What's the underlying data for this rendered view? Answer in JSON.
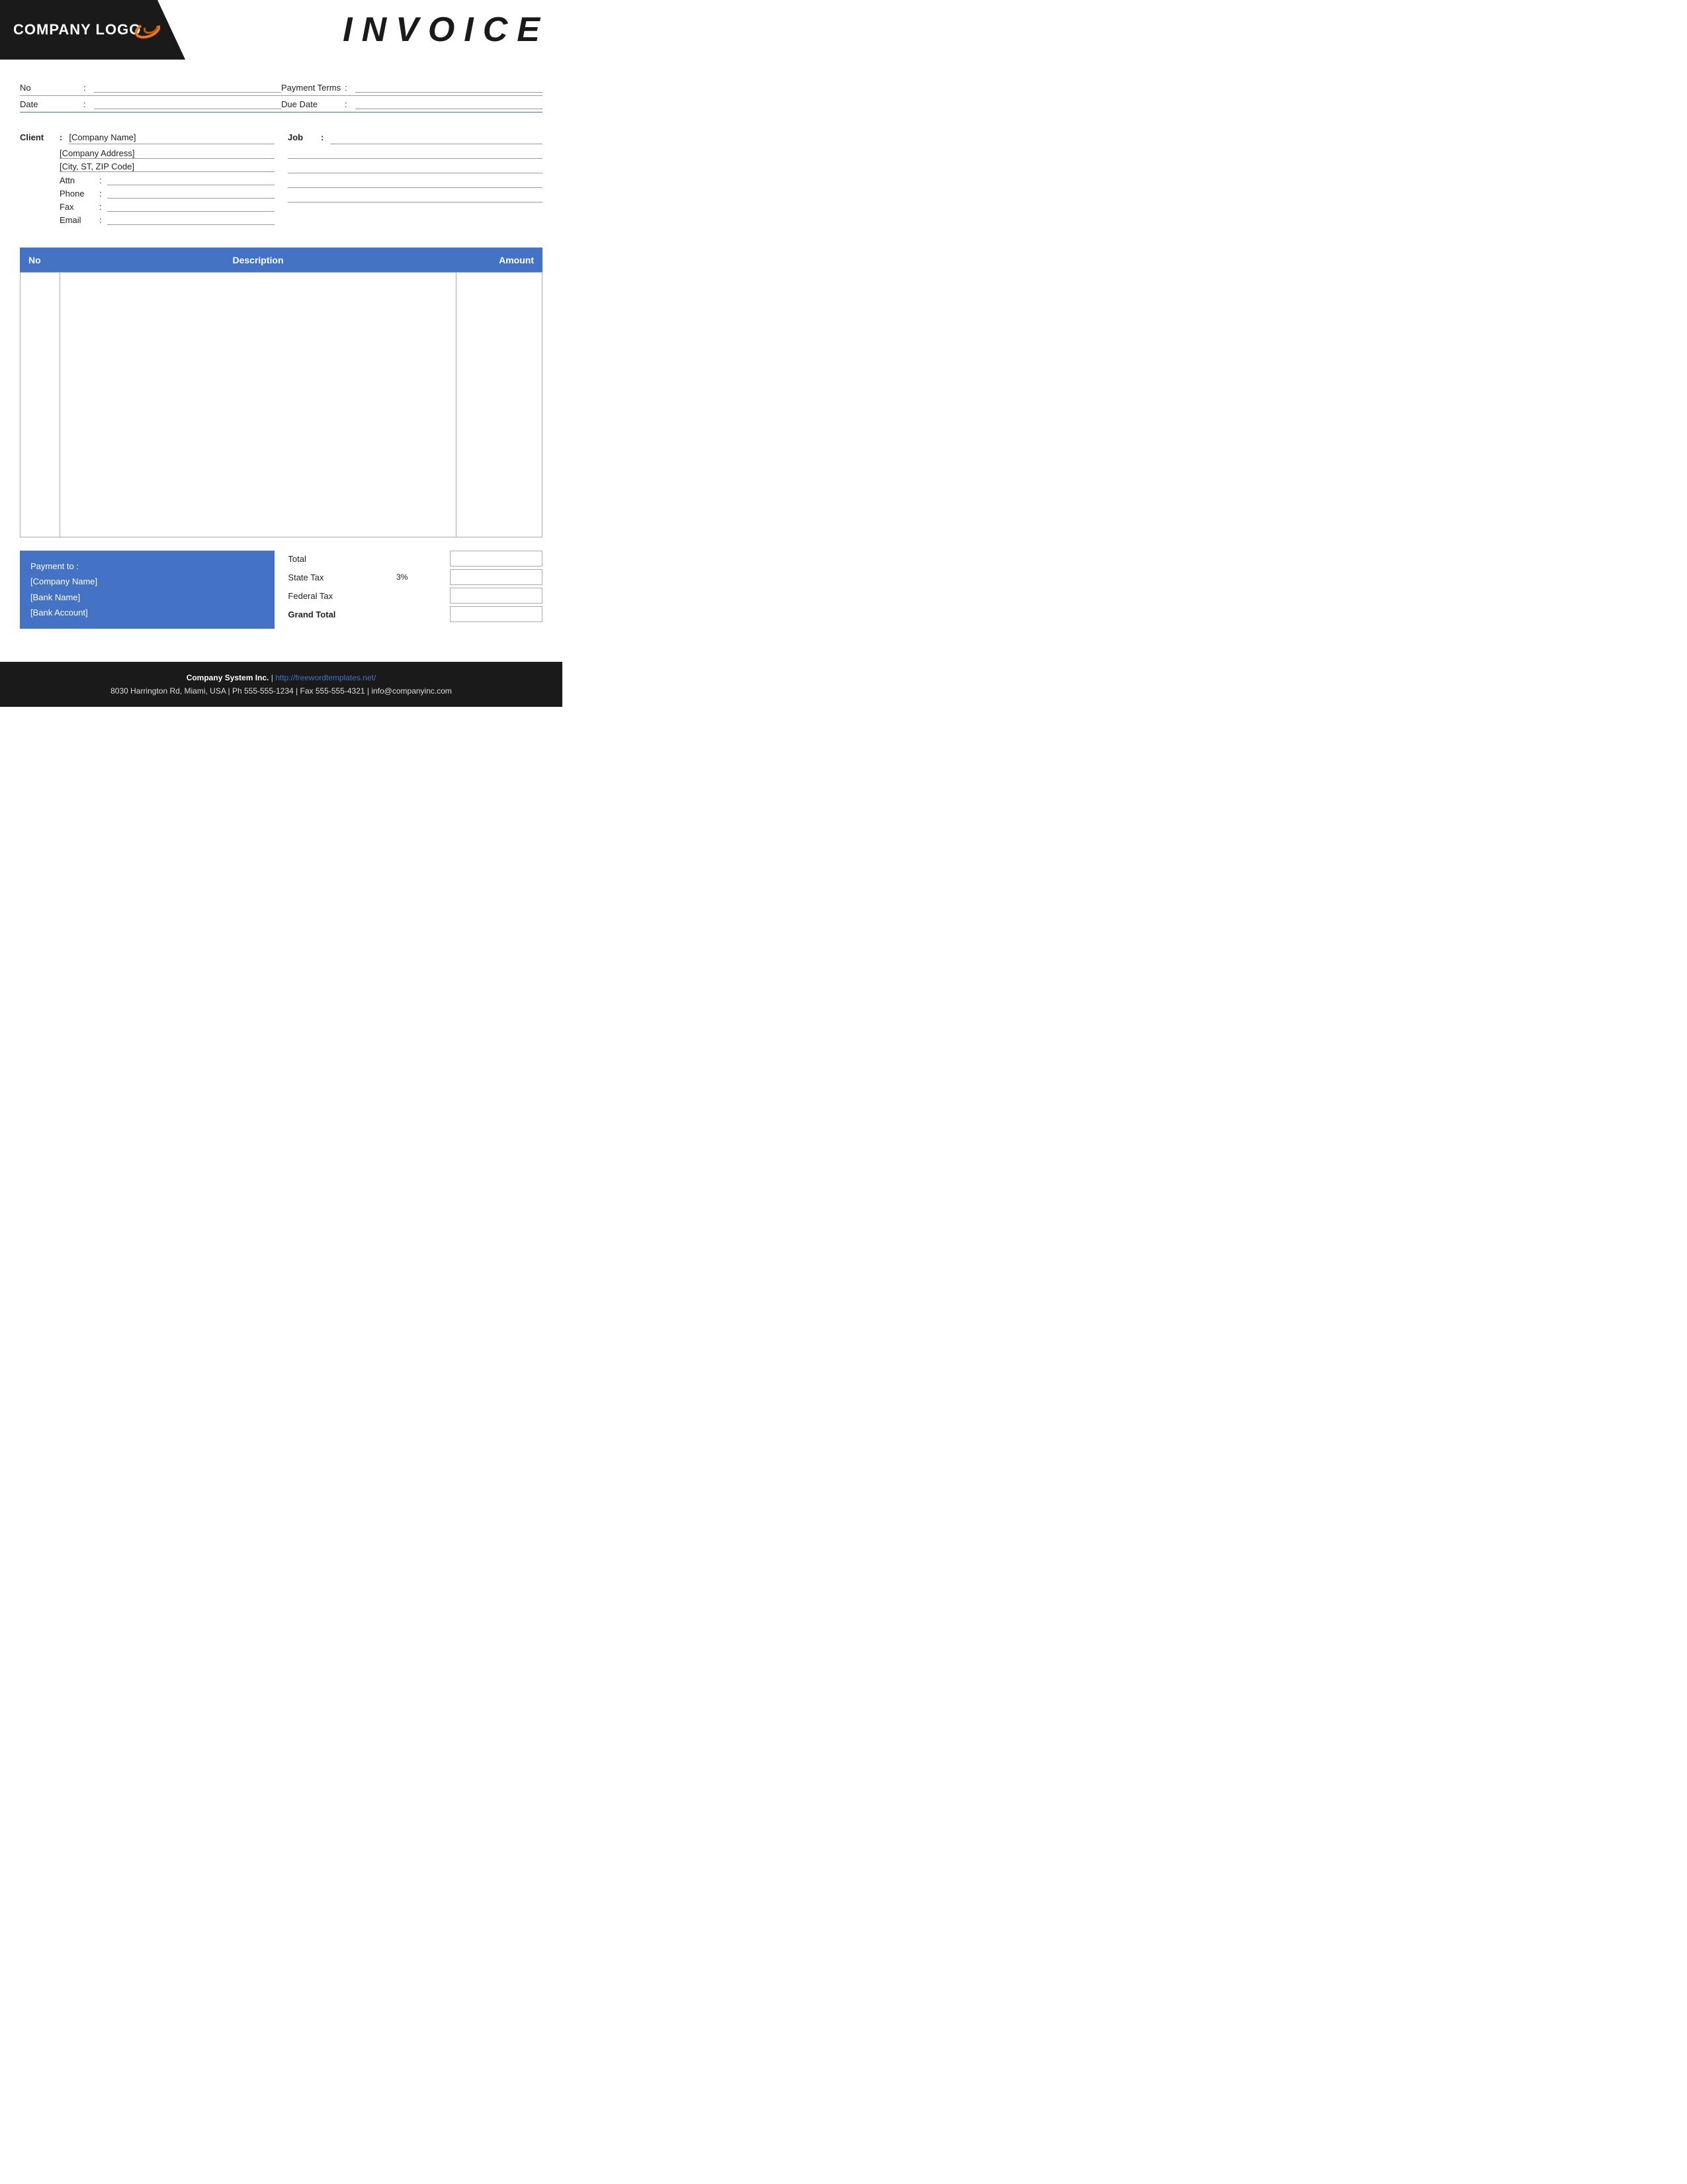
{
  "header": {
    "logo_text": "COMPANY LOGO",
    "invoice_title": "INVOICE"
  },
  "meta": {
    "rows": [
      {
        "left_label": "No",
        "left_value": "",
        "right_label": "Payment  Terms",
        "right_value": ""
      },
      {
        "left_label": "Date",
        "left_value": "",
        "right_label": "Due Date",
        "right_value": ""
      }
    ]
  },
  "client": {
    "label": "Client",
    "colon": ":",
    "company_name": "[Company Name]",
    "company_address": "[Company Address]",
    "city_state_zip": "[City, ST, ZIP Code]",
    "fields": [
      {
        "label": "Attn",
        "colon": ":",
        "value": ""
      },
      {
        "label": "Phone",
        "colon": ":",
        "value": ""
      },
      {
        "label": "Fax",
        "colon": ":",
        "value": ""
      },
      {
        "label": "Email",
        "colon": ":",
        "value": ""
      }
    ]
  },
  "job": {
    "label": "Job",
    "colon": ":",
    "value": "",
    "extra_lines": [
      "",
      "",
      "",
      ""
    ]
  },
  "table": {
    "columns": [
      {
        "key": "no",
        "label": "No"
      },
      {
        "key": "description",
        "label": "Description"
      },
      {
        "key": "amount",
        "label": "Amount"
      }
    ],
    "rows": []
  },
  "payment": {
    "title": "Payment to :",
    "company": "[Company Name]",
    "bank": "[Bank Name]",
    "account": "[Bank Account]"
  },
  "totals": {
    "rows": [
      {
        "label": "Total",
        "tax_pct": "",
        "bold": false
      },
      {
        "label": "State Tax",
        "tax_pct": "3%",
        "bold": false
      },
      {
        "label": "Federal Tax",
        "tax_pct": "",
        "bold": false
      },
      {
        "label": "Grand Total",
        "tax_pct": "",
        "bold": true
      }
    ]
  },
  "footer": {
    "company": "Company System Inc.",
    "separator": "|",
    "website": "http://freewordtemplates.net/",
    "address": "8030 Harrington Rd, Miami, USA | Ph 555-555-1234 | Fax 555-555-4321 | info@companyinc.com"
  }
}
